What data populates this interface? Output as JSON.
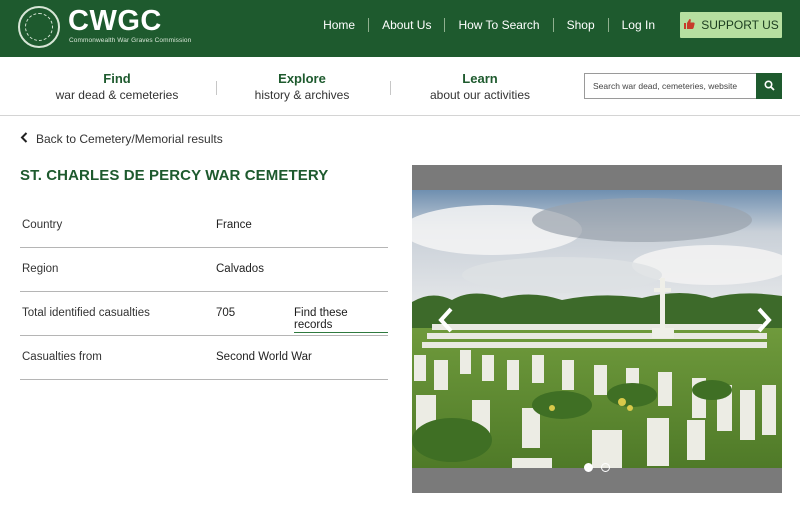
{
  "brand": {
    "name": "CWGC",
    "tagline": "Commonwealth War Graves Commission"
  },
  "topnav": {
    "items": [
      "Home",
      "About Us",
      "How To Search",
      "Shop",
      "Log In"
    ],
    "support_label": "SUPPORT US"
  },
  "subnav": {
    "find": {
      "title": "Find",
      "subtitle": "war dead & cemeteries"
    },
    "explore": {
      "title": "Explore",
      "subtitle": "history & archives"
    },
    "learn": {
      "title": "Learn",
      "subtitle": "about our activities"
    }
  },
  "search": {
    "placeholder": "Search war dead, cemeteries, website"
  },
  "back_link": "Back to Cemetery/Memorial results",
  "page_title": "ST. CHARLES DE PERCY WAR CEMETERY",
  "details": {
    "country": {
      "label": "Country",
      "value": "France"
    },
    "region": {
      "label": "Region",
      "value": "Calvados"
    },
    "casualties": {
      "label": "Total identified casualties",
      "value": "705",
      "link": "Find these records"
    },
    "from": {
      "label": "Casualties from",
      "value": "Second World War"
    }
  },
  "carousel": {
    "slide_count": 2,
    "active_index": 0
  },
  "colors": {
    "brand_green": "#1e5a2e",
    "support_bg": "#b6dfa0",
    "link_underline": "#2f7a3f"
  },
  "icons": [
    "cwgc-seal-logo",
    "thumbs-up-icon",
    "search-icon",
    "chevron-left-icon",
    "arrow-left-icon",
    "arrow-right-icon"
  ]
}
